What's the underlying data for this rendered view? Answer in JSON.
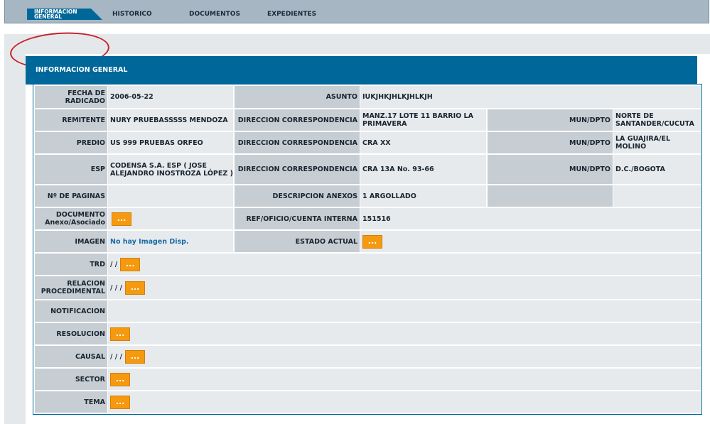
{
  "tabs": [
    {
      "label": "INFORMACION GENERAL"
    },
    {
      "label": "HISTORICO"
    },
    {
      "label": "DOCUMENTOS"
    },
    {
      "label": "EXPEDIENTES"
    }
  ],
  "header": {
    "title": "INFORMACION GENERAL"
  },
  "fields": {
    "fecha_radicado": {
      "label": "FECHA DE RADICADO",
      "value": "2006-05-22"
    },
    "asunto": {
      "label": "ASUNTO",
      "value": "IUKJHKJHLKJHLKJH"
    },
    "remitente": {
      "label": "REMITENTE",
      "value": "NURY PRUEBASSSSS MENDOZA"
    },
    "dir1": {
      "label": "DIRECCION CORRESPONDENCIA",
      "value": "MANZ.17 LOTE 11 BARRIO LA PRIMAVERA"
    },
    "mun1": {
      "label": "MUN/DPTO",
      "value": "NORTE DE SANTANDER/CUCUTA"
    },
    "predio": {
      "label": "PREDIO",
      "value": "US 999 PRUEBAS ORFEO"
    },
    "dir2": {
      "label": "DIRECCION CORRESPONDENCIA",
      "value": "CRA XX"
    },
    "mun2": {
      "label": "MUN/DPTO",
      "value": "LA GUAJIRA/EL MOLINO"
    },
    "esp": {
      "label": "ESP",
      "value": "CODENSA S.A. ESP ( JOSE ALEJANDRO INOSTROZA LÓPEZ )"
    },
    "dir3": {
      "label": "DIRECCION CORRESPONDENCIA",
      "value": "CRA 13A No. 93-66"
    },
    "mun3": {
      "label": "MUN/DPTO",
      "value": "D.C./BOGOTA"
    },
    "paginas": {
      "label": "Nº DE PAGINAS",
      "value": ""
    },
    "anexos": {
      "label": "DESCRIPCION ANEXOS",
      "value": "1 ARGOLLADO"
    },
    "documento": {
      "label": "DOCUMENTO Anexo/Asociado"
    },
    "ref": {
      "label": "REF/OFICIO/CUENTA INTERNA",
      "value": "151516"
    },
    "imagen": {
      "label": "IMAGEN",
      "value": "No hay Imagen Disp."
    },
    "estado": {
      "label": "ESTADO ACTUAL"
    },
    "trd": {
      "label": "TRD",
      "value": "/ /"
    },
    "relacion": {
      "label": "RELACION PROCEDIMENTAL",
      "value": "/ / /"
    },
    "notificacion": {
      "label": "NOTIFICACION"
    },
    "resolucion": {
      "label": "RESOLUCION"
    },
    "causal": {
      "label": "CAUSAL",
      "value": "/ / /"
    },
    "sector": {
      "label": "SECTOR"
    },
    "tema": {
      "label": "TEMA"
    }
  },
  "button_label": "...",
  "colors": {
    "accent": "#00679a",
    "button": "#f59a10",
    "label_bg": "#c6cdd3",
    "value_bg": "#e6eaed",
    "highlight": "#c8202a"
  }
}
